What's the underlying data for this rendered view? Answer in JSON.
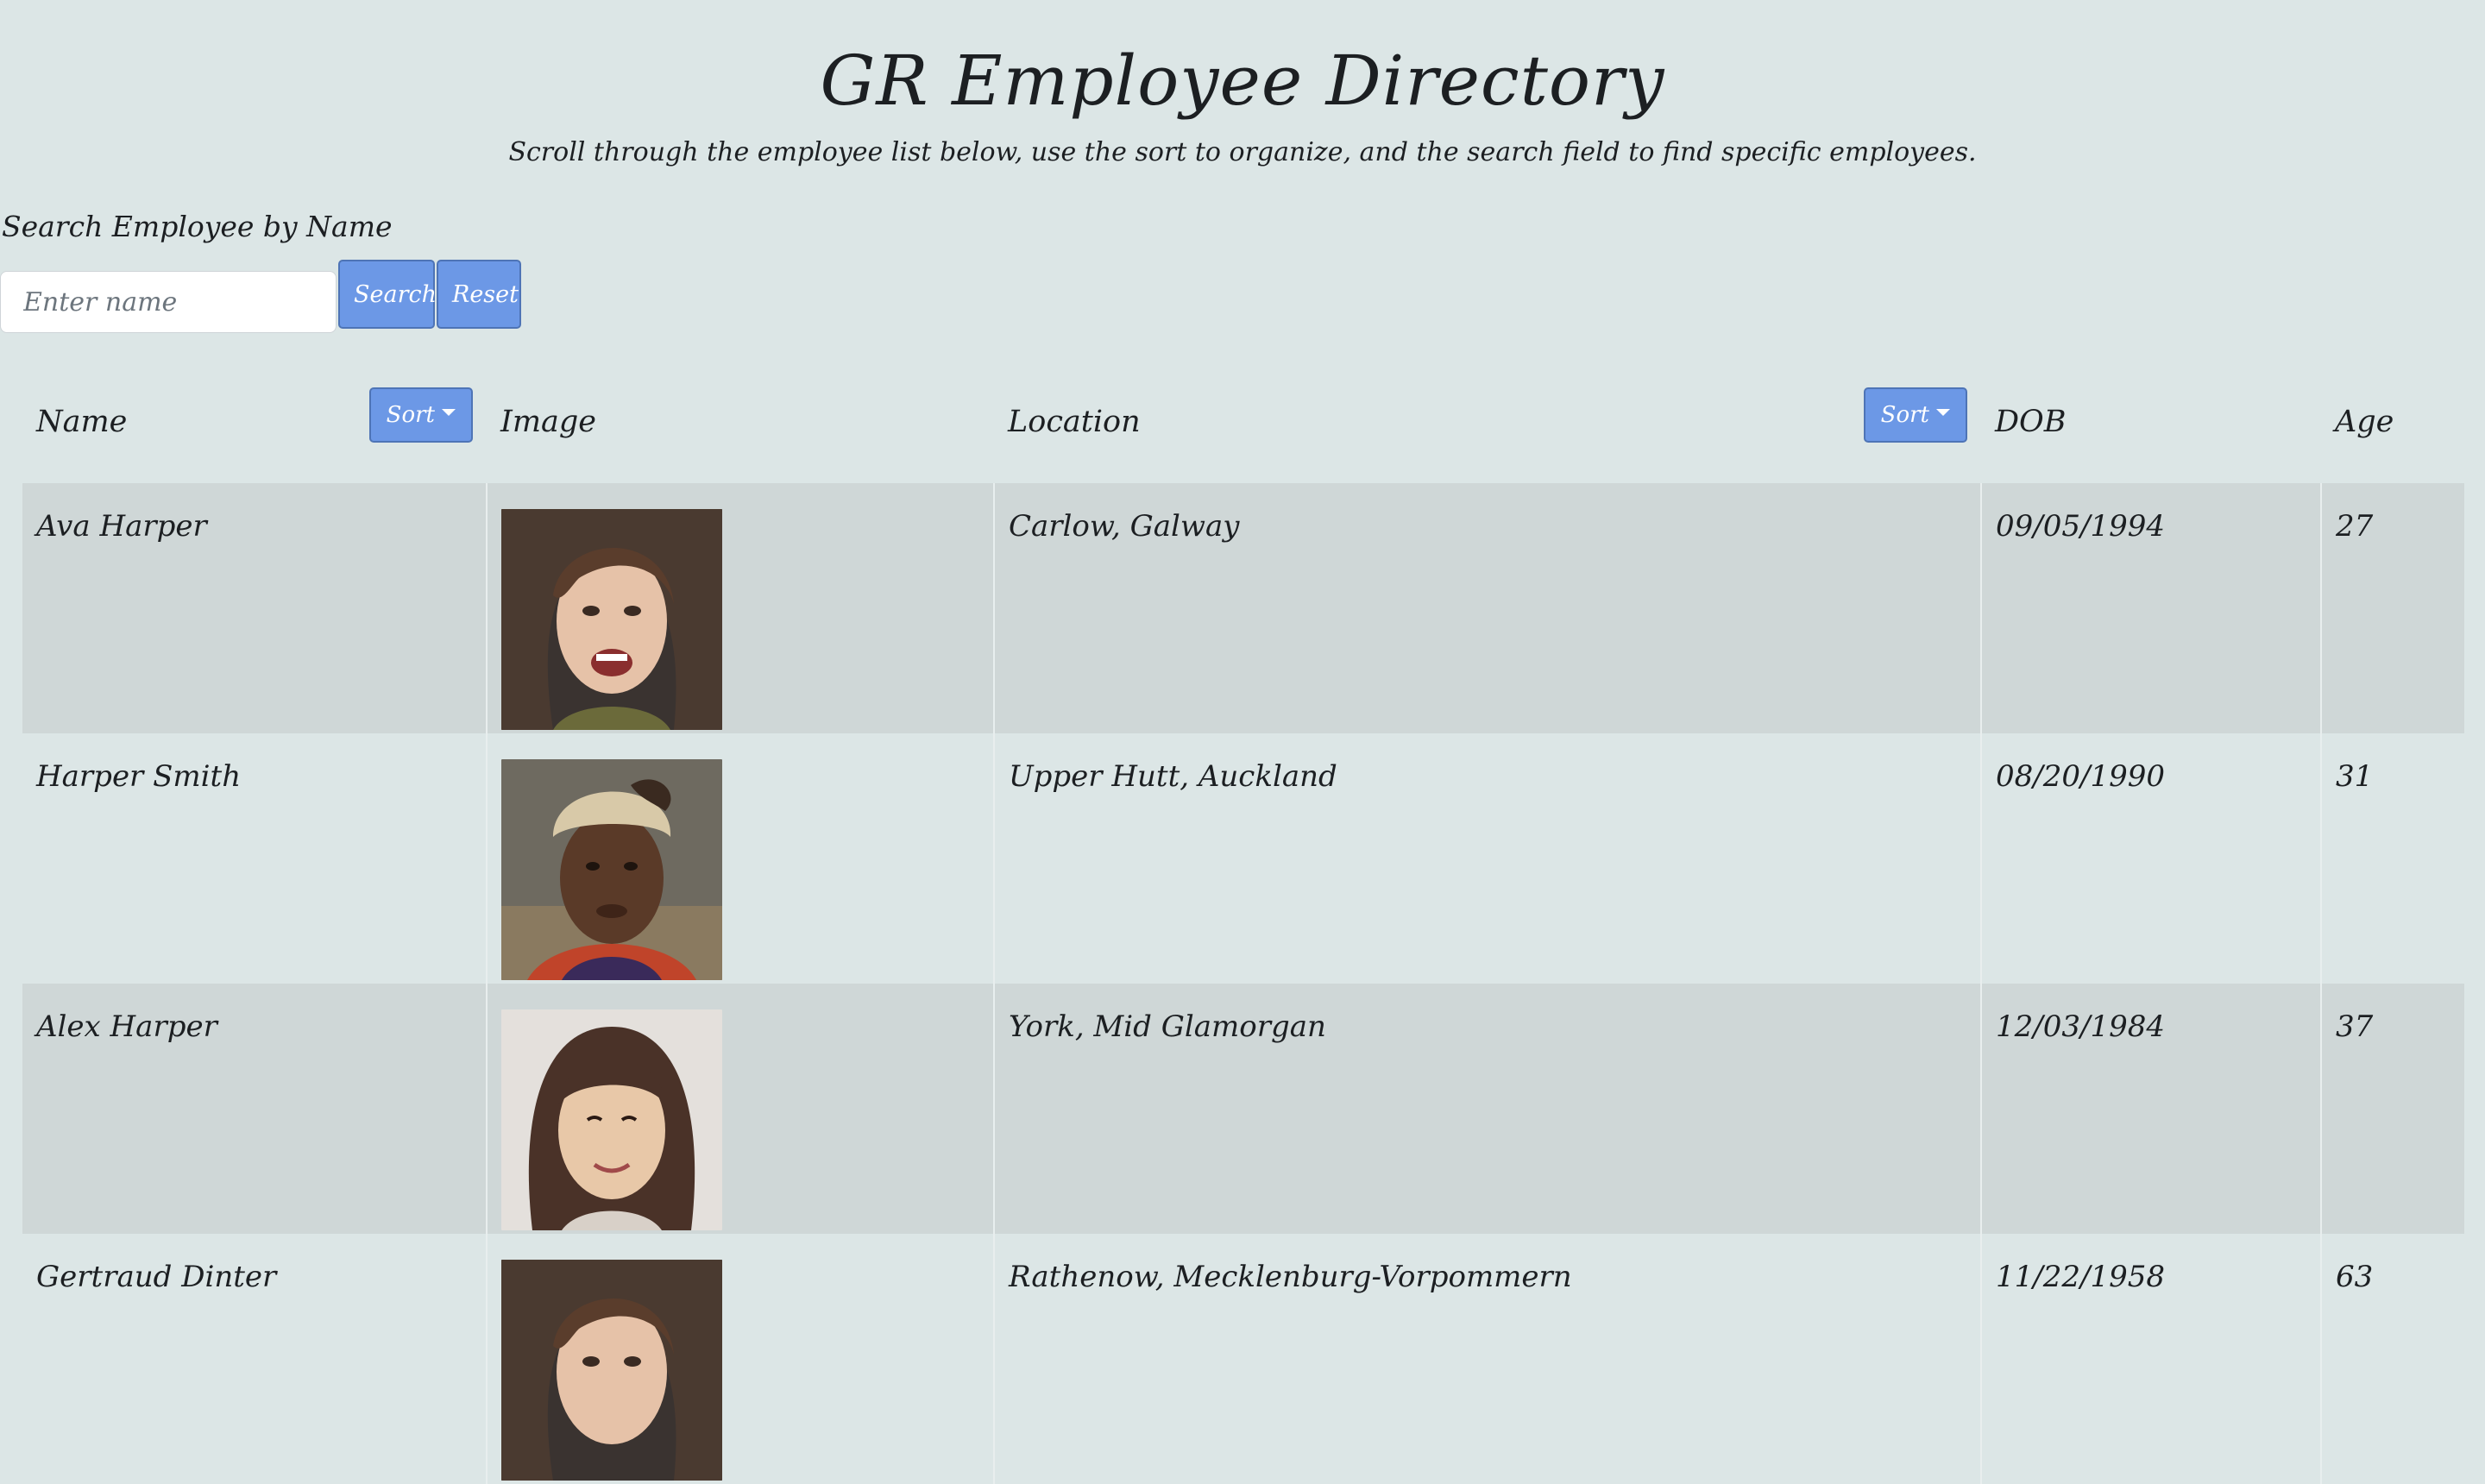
{
  "header": {
    "title": "GR Employee Directory",
    "subtitle": "Scroll through the employee list below, use the sort to organize, and the search field to find specific employees."
  },
  "search": {
    "label": "Search Employee by Name",
    "placeholder": "Enter name",
    "value": "",
    "search_button": "Search",
    "reset_button": "Reset"
  },
  "table": {
    "columns": {
      "name": "Name",
      "image": "Image",
      "location": "Location",
      "dob": "DOB",
      "age": "Age"
    },
    "sort_label": "Sort",
    "rows": [
      {
        "name": "Ava Harper",
        "location": "Carlow, Galway",
        "dob": "09/05/1994",
        "age": "27",
        "photo": "portrait-woman-smiling"
      },
      {
        "name": "Harper Smith",
        "location": "Upper Hutt, Auckland",
        "dob": "08/20/1990",
        "age": "31",
        "photo": "portrait-woman-headwrap"
      },
      {
        "name": "Alex Harper",
        "location": "York, Mid Glamorgan",
        "dob": "12/03/1984",
        "age": "37",
        "photo": "portrait-woman-bangs"
      },
      {
        "name": "Gertraud Dinter",
        "location": "Rathenow, Mecklenburg-Vorpommern",
        "dob": "11/22/1958",
        "age": "63",
        "photo": "portrait-woman-smiling"
      }
    ]
  },
  "colors": {
    "background": "#dce6e6",
    "row_stripe": "#cfd7d7",
    "accent_button": "#6c98e6"
  }
}
